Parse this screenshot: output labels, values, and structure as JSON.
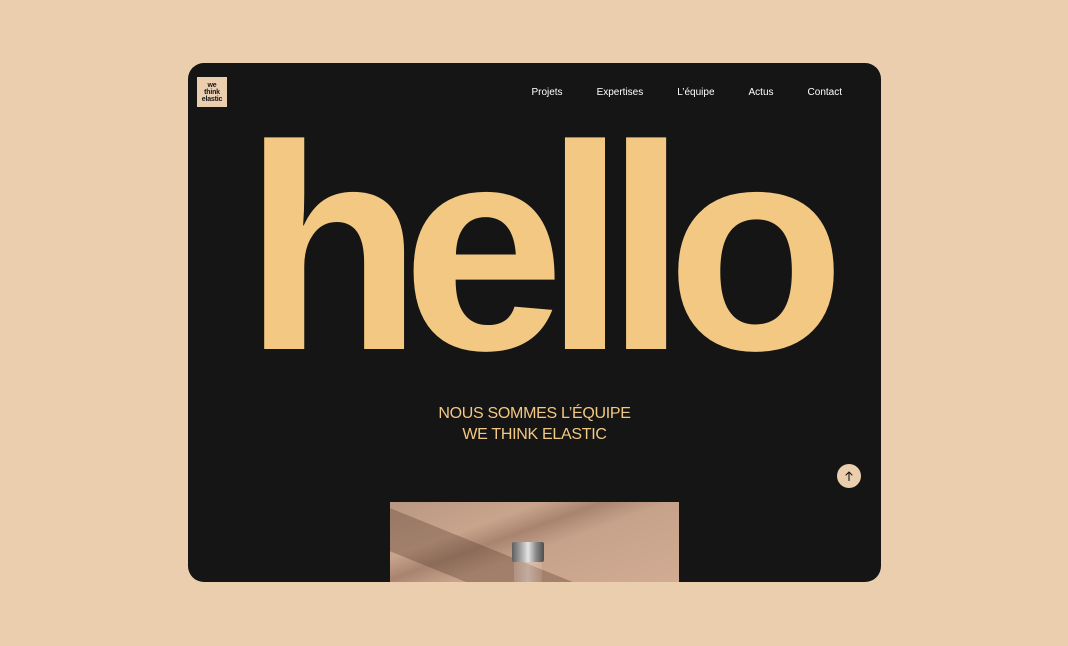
{
  "brand": {
    "logo_lines": [
      "we",
      "think",
      "elastic"
    ]
  },
  "nav": {
    "items": [
      {
        "label": "Projets"
      },
      {
        "label": "Expertises"
      },
      {
        "label": "L’équipe"
      },
      {
        "label": "Actus"
      },
      {
        "label": "Contact"
      }
    ]
  },
  "hero": {
    "word": "hello",
    "tagline_line1": "NOUS SOMMES L’ÉQUIPE",
    "tagline_line2": "WE THINK ELASTIC"
  },
  "colors": {
    "background": "#ebceae",
    "panel": "#151515",
    "accent": "#f2c882",
    "nav_text": "#ffffff"
  },
  "icons": {
    "scroll_top": "arrow-up-icon"
  }
}
